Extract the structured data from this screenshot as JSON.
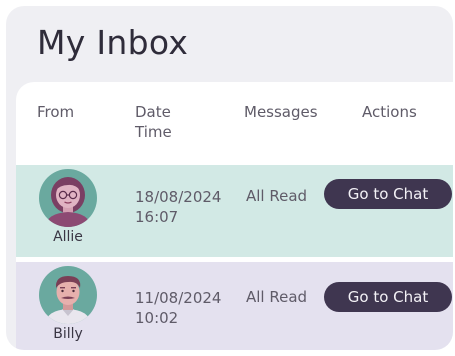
{
  "inbox": {
    "title": "My Inbox",
    "headers": {
      "from": "From",
      "date_line1": "Date",
      "date_line2": "Time",
      "messages": "Messages",
      "actions": "Actions"
    },
    "rows": [
      {
        "name": "Allie",
        "date": "18/08/2024",
        "time": "16:07",
        "status": "All Read",
        "action_label": "Go to Chat",
        "avatar_icon": "woman-avatar-icon"
      },
      {
        "name": "Billy",
        "date": "11/08/2024",
        "time": "10:02",
        "status": "All Read",
        "action_label": "Go to Chat",
        "avatar_icon": "man-avatar-icon"
      }
    ]
  },
  "colors": {
    "background": "#efeff3",
    "row_teal": "#d2e9e5",
    "row_lavender": "#e4e1ef",
    "button": "#3f3650",
    "avatar_bg": "#6aa99f"
  }
}
